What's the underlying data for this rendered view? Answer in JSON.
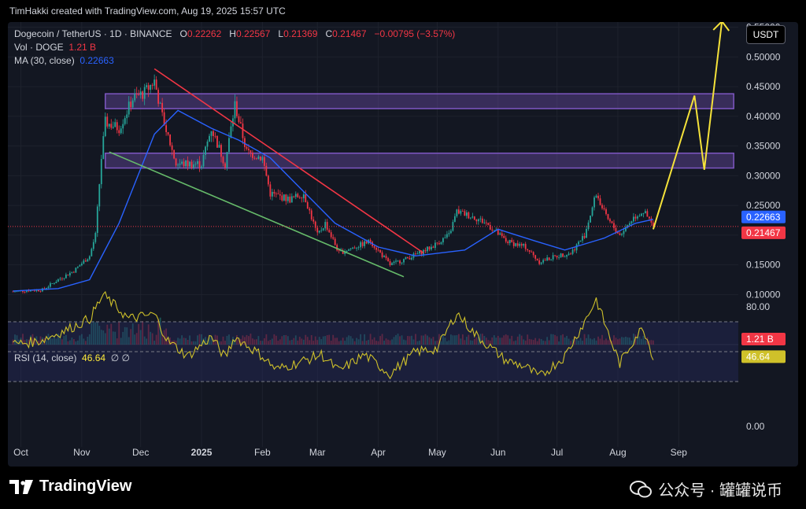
{
  "header": {
    "credit": "TimHakki created with TradingView.com, Aug 19, 2025 15:57 UTC"
  },
  "legend": {
    "symbol": "Dogecoin / TetherUS · 1D · BINANCE",
    "o_label": "O",
    "o_value": "0.22262",
    "h_label": "H",
    "h_value": "0.22567",
    "l_label": "L",
    "l_value": "0.21369",
    "c_label": "C",
    "c_value": "0.21467",
    "change": "−0.00795 (−3.57%)",
    "vol_label": "Vol · DOGE",
    "vol_value": "1.21 B",
    "ma_label": "MA (30, close)",
    "ma_value": "0.22663"
  },
  "rsi_legend": {
    "label": "RSI (14, close)",
    "value": "46.64",
    "icons": "∅ ∅"
  },
  "currency_button": "USDT",
  "price_tags": {
    "ma": "0.22663",
    "last": "0.21467",
    "volume": "1.21 B",
    "rsi": "46.64"
  },
  "footer": {
    "brand": "TradingView",
    "wechat": "公众号 · 罐罐说币"
  },
  "colors": {
    "up": "#26a69a",
    "down": "#f23645",
    "ma": "#2962ff",
    "rsi": "#cfc12a",
    "zone": "#7e57c2",
    "resistance": "#f23645",
    "support": "#66bb6a",
    "projection": "#f5e23a"
  },
  "chart_data": {
    "type": "candlestick",
    "title": "Dogecoin / TetherUS · 1D · BINANCE",
    "y_ticks": [
      "0.55000",
      "0.50000",
      "0.45000",
      "0.40000",
      "0.35000",
      "0.30000",
      "0.25000",
      "0.20000",
      "0.15000",
      "0.10000"
    ],
    "x_ticks": [
      "Oct",
      "Nov",
      "Dec",
      "2025",
      "Feb",
      "Mar",
      "Apr",
      "May",
      "Jun",
      "Jul",
      "Aug",
      "Sep"
    ],
    "rsi_ticks": [
      "80.00",
      "0.00"
    ],
    "price_path": [
      [
        "2024-09-27",
        0.105
      ],
      [
        "2024-10-05",
        0.107
      ],
      [
        "2024-10-12",
        0.108
      ],
      [
        "2024-10-20",
        0.125
      ],
      [
        "2024-10-28",
        0.14
      ],
      [
        "2024-11-05",
        0.165
      ],
      [
        "2024-11-08",
        0.2
      ],
      [
        "2024-11-11",
        0.33
      ],
      [
        "2024-11-13",
        0.39
      ],
      [
        "2024-11-20",
        0.38
      ],
      [
        "2024-11-27",
        0.43
      ],
      [
        "2024-12-03",
        0.44
      ],
      [
        "2024-12-08",
        0.46
      ],
      [
        "2024-12-12",
        0.4
      ],
      [
        "2024-12-19",
        0.32
      ],
      [
        "2024-12-25",
        0.32
      ],
      [
        "2025-01-01",
        0.32
      ],
      [
        "2025-01-06",
        0.38
      ],
      [
        "2025-01-13",
        0.32
      ],
      [
        "2025-01-18",
        0.42
      ],
      [
        "2025-01-24",
        0.34
      ],
      [
        "2025-02-01",
        0.33
      ],
      [
        "2025-02-05",
        0.27
      ],
      [
        "2025-02-15",
        0.26
      ],
      [
        "2025-02-22",
        0.27
      ],
      [
        "2025-03-01",
        0.2
      ],
      [
        "2025-03-05",
        0.22
      ],
      [
        "2025-03-12",
        0.17
      ],
      [
        "2025-03-20",
        0.18
      ],
      [
        "2025-03-28",
        0.19
      ],
      [
        "2025-04-07",
        0.15
      ],
      [
        "2025-04-15",
        0.16
      ],
      [
        "2025-04-22",
        0.17
      ],
      [
        "2025-04-28",
        0.18
      ],
      [
        "2025-05-07",
        0.2
      ],
      [
        "2025-05-11",
        0.24
      ],
      [
        "2025-05-20",
        0.23
      ],
      [
        "2025-05-26",
        0.22
      ],
      [
        "2025-06-05",
        0.19
      ],
      [
        "2025-06-15",
        0.18
      ],
      [
        "2025-06-22",
        0.155
      ],
      [
        "2025-07-01",
        0.165
      ],
      [
        "2025-07-08",
        0.17
      ],
      [
        "2025-07-15",
        0.2
      ],
      [
        "2025-07-21",
        0.27
      ],
      [
        "2025-07-26",
        0.23
      ],
      [
        "2025-08-02",
        0.2
      ],
      [
        "2025-08-09",
        0.23
      ],
      [
        "2025-08-14",
        0.24
      ],
      [
        "2025-08-19",
        0.2147
      ]
    ],
    "ma30": [
      [
        "2024-09-27",
        0.106
      ],
      [
        "2024-10-20",
        0.11
      ],
      [
        "2024-11-05",
        0.125
      ],
      [
        "2024-11-20",
        0.22
      ],
      [
        "2024-12-08",
        0.37
      ],
      [
        "2024-12-20",
        0.41
      ],
      [
        "2025-01-06",
        0.38
      ],
      [
        "2025-01-20",
        0.36
      ],
      [
        "2025-02-05",
        0.33
      ],
      [
        "2025-02-20",
        0.28
      ],
      [
        "2025-03-10",
        0.22
      ],
      [
        "2025-04-01",
        0.18
      ],
      [
        "2025-04-20",
        0.165
      ],
      [
        "2025-05-15",
        0.175
      ],
      [
        "2025-06-01",
        0.21
      ],
      [
        "2025-06-20",
        0.19
      ],
      [
        "2025-07-05",
        0.175
      ],
      [
        "2025-07-25",
        0.195
      ],
      [
        "2025-08-10",
        0.22
      ],
      [
        "2025-08-19",
        0.2266
      ]
    ],
    "zones": [
      {
        "from": "2024-11-13",
        "to": "2025-09-29",
        "low": 0.413,
        "high": 0.438
      },
      {
        "from": "2024-11-13",
        "to": "2025-09-29",
        "low": 0.313,
        "high": 0.338
      }
    ],
    "resistance_line": [
      [
        "2024-12-08",
        0.48
      ],
      [
        "2025-04-24",
        0.17
      ]
    ],
    "support_line": [
      [
        "2024-11-15",
        0.34
      ],
      [
        "2025-04-14",
        0.13
      ]
    ],
    "projection": [
      [
        "2025-08-19",
        0.21
      ],
      [
        "2025-09-09",
        0.435
      ],
      [
        "2025-09-14",
        0.31
      ],
      [
        "2025-09-23",
        0.56
      ]
    ],
    "rsi": [
      [
        "2024-09-27",
        55
      ],
      [
        "2024-10-10",
        57
      ],
      [
        "2024-10-25",
        65
      ],
      [
        "2024-11-05",
        72
      ],
      [
        "2024-11-12",
        88
      ],
      [
        "2024-11-25",
        72
      ],
      [
        "2024-12-08",
        75
      ],
      [
        "2024-12-15",
        57
      ],
      [
        "2024-12-25",
        47
      ],
      [
        "2025-01-06",
        60
      ],
      [
        "2025-01-13",
        46
      ],
      [
        "2025-01-18",
        60
      ],
      [
        "2025-02-01",
        47
      ],
      [
        "2025-02-08",
        38
      ],
      [
        "2025-02-20",
        43
      ],
      [
        "2025-03-03",
        48
      ],
      [
        "2025-03-12",
        37
      ],
      [
        "2025-03-25",
        48
      ],
      [
        "2025-04-07",
        35
      ],
      [
        "2025-04-20",
        50
      ],
      [
        "2025-05-01",
        52
      ],
      [
        "2025-05-11",
        76
      ],
      [
        "2025-05-20",
        62
      ],
      [
        "2025-06-05",
        44
      ],
      [
        "2025-06-15",
        40
      ],
      [
        "2025-06-22",
        33
      ],
      [
        "2025-07-05",
        47
      ],
      [
        "2025-07-15",
        70
      ],
      [
        "2025-07-21",
        85
      ],
      [
        "2025-07-28",
        59
      ],
      [
        "2025-08-02",
        42
      ],
      [
        "2025-08-10",
        60
      ],
      [
        "2025-08-14",
        66
      ],
      [
        "2025-08-19",
        46.6
      ]
    ],
    "rsi_bands": [
      30,
      50,
      70
    ]
  }
}
